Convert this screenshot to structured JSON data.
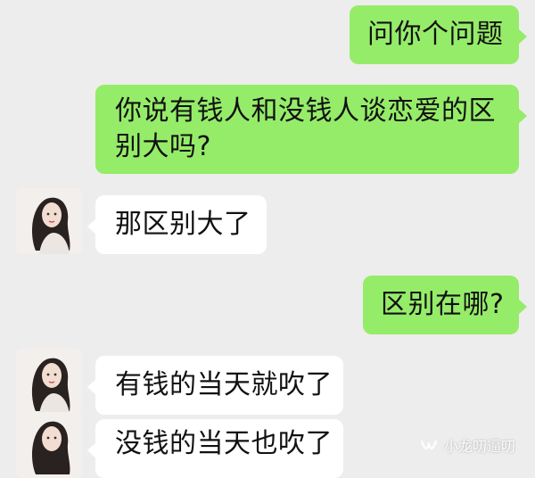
{
  "messages": [
    {
      "sender": "me",
      "text": "问你个问题"
    },
    {
      "sender": "me",
      "text": "你说有钱人和没钱人谈恋爱的区别大吗?"
    },
    {
      "sender": "other",
      "text": "那区别大了"
    },
    {
      "sender": "me",
      "text": "区别在哪?"
    },
    {
      "sender": "other",
      "text": "有钱的当天就吹了"
    },
    {
      "sender": "other",
      "text": "没钱的当天也吹了"
    }
  ],
  "avatar": {
    "icon": "woman-portrait-avatar"
  },
  "watermark": {
    "text": "小龙叨逼叨",
    "icon": "wechat-channel-icon"
  },
  "colors": {
    "background": "#ededed",
    "my_bubble": "#95ec69",
    "other_bubble": "#ffffff"
  }
}
